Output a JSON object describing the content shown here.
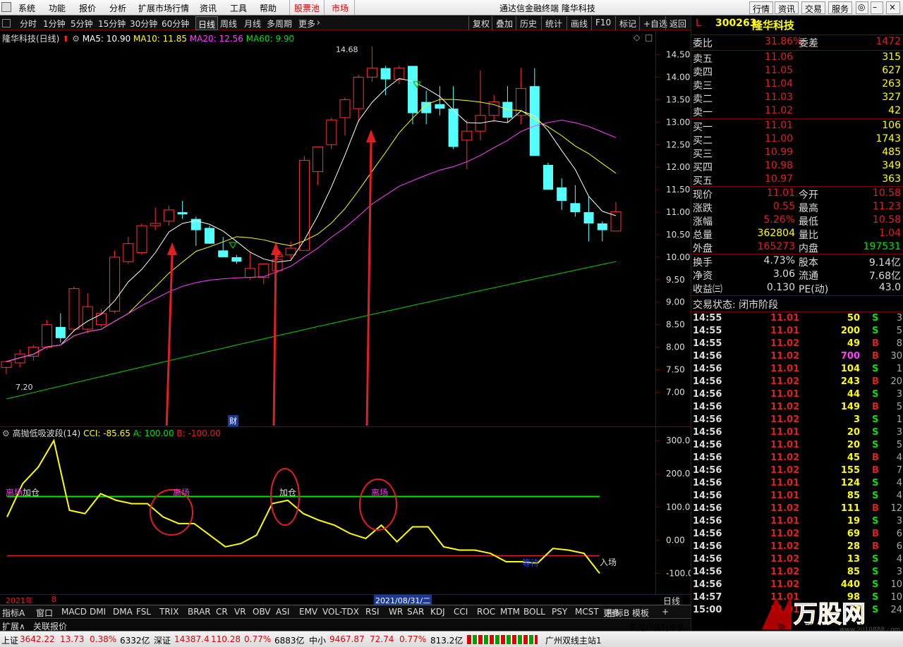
{
  "menu": {
    "items": [
      "系统",
      "功能",
      "报价",
      "分析",
      "扩展市场行情",
      "资讯",
      "工具",
      "帮助"
    ],
    "pool": "股票池",
    "market": "市场",
    "title": "通达信金融终端  隆华科技",
    "right_btns": [
      "行情",
      "资讯",
      "交易",
      "服务"
    ]
  },
  "toolbar": {
    "periods": [
      "分时",
      "1分钟",
      "5分钟",
      "15分钟",
      "30分钟",
      "60分钟",
      "日线",
      "周线",
      "月线",
      "多周期",
      "更多"
    ],
    "selected": "日线",
    "right": [
      "复权",
      "叠加",
      "历史",
      "统计",
      "画线",
      "F10",
      "标记",
      "+自选",
      "返回"
    ]
  },
  "chart_info": {
    "name": "隆华科技(日线)",
    "ma5": "MA5: 10.90",
    "ma10": "MA10: 11.85",
    "ma20": "MA20: 12.56",
    "ma60": "MA60: 9.90",
    "high_label": "14.68",
    "low_label": "7.20",
    "cai": "财"
  },
  "osc_info": {
    "name": "高抛低吸波段(14)",
    "cci": "CCI: -85.65",
    "a": "A: 100.00",
    "b": "B: -100.00"
  },
  "osc_labels": {
    "l1": "离场",
    "l2": "加仓",
    "l3": "离场",
    "l4": "加仓",
    "l5": "离场",
    "l6": "等待",
    "l7": "入场"
  },
  "price_ticks": [
    "14.50",
    "14.00",
    "13.50",
    "13.00",
    "12.50",
    "12.00",
    "11.50",
    "11.00",
    "10.50",
    "10.00",
    "9.50",
    "9.00",
    "8.50",
    "8.00",
    "7.50",
    "7.00"
  ],
  "osc_ticks": [
    "300.0",
    "200.0",
    "100.0",
    "0.00",
    "-100.0"
  ],
  "status": {
    "year": "2021年",
    "month": "8",
    "date": "2021/08/31/二",
    "period": "日线"
  },
  "ind_tabs": [
    "指标A",
    "窗口",
    "MACD",
    "DMI",
    "DMA",
    "FSL",
    "TRIX",
    "BRAR",
    "CR",
    "VR",
    "OBV",
    "ASI",
    "EMV",
    "VOL-TDX",
    "RSI",
    "WR",
    "SAR",
    "KDJ",
    "CCI",
    "ROC",
    "MTM",
    "BOLL",
    "PSY",
    "MCST",
    "更多"
  ],
  "ind_tabs_right": [
    "指标B",
    "模板",
    "+"
  ],
  "ext_tabs": [
    "扩展∧",
    "关联报价"
  ],
  "quote": {
    "code": "300263",
    "name": "隆华科技",
    "mark": "L",
    "webi": "委比",
    "webi_v": "31.86%",
    "weicha": "委差",
    "weicha_v": "1472",
    "asks": [
      [
        "卖五",
        "11.06",
        "315"
      ],
      [
        "卖四",
        "11.05",
        "627"
      ],
      [
        "卖三",
        "11.04",
        "263"
      ],
      [
        "卖二",
        "11.03",
        "327"
      ],
      [
        "卖一",
        "11.02",
        "42"
      ]
    ],
    "bids": [
      [
        "买一",
        "11.01",
        "106"
      ],
      [
        "买二",
        "11.00",
        "1743"
      ],
      [
        "买三",
        "10.99",
        "485"
      ],
      [
        "买四",
        "10.98",
        "349"
      ],
      [
        "买五",
        "10.97",
        "363"
      ]
    ],
    "stats": [
      [
        "现价",
        "11.01",
        "今开",
        "10.58"
      ],
      [
        "涨跌",
        "0.55",
        "最高",
        "11.23"
      ],
      [
        "涨幅",
        "5.26%",
        "最低",
        "10.58"
      ],
      [
        "总量",
        "362804",
        "量比",
        "1.04"
      ],
      [
        "外盘",
        "165273",
        "内盘",
        "197531"
      ]
    ],
    "stats2": [
      [
        "换手",
        "4.73%",
        "股本",
        "9.14亿"
      ],
      [
        "净资",
        "3.06",
        "流通",
        "7.68亿"
      ],
      [
        "收益㈢",
        "0.130",
        "PE(动)",
        "43.0"
      ]
    ],
    "trade_state": "交易状态: 闭市阶段"
  },
  "ticks": [
    [
      "14:55",
      "11.01",
      "50",
      "S",
      "3"
    ],
    [
      "14:55",
      "11.01",
      "200",
      "S",
      "5"
    ],
    [
      "14:55",
      "11.02",
      "49",
      "B",
      "8"
    ],
    [
      "14:56",
      "11.02",
      "700",
      "B",
      "30"
    ],
    [
      "14:56",
      "11.01",
      "104",
      "S",
      "1"
    ],
    [
      "14:56",
      "11.02",
      "243",
      "B",
      "20"
    ],
    [
      "14:56",
      "11.01",
      "44",
      "S",
      "3"
    ],
    [
      "14:56",
      "11.02",
      "149",
      "B",
      "5"
    ],
    [
      "14:56",
      "11.02",
      "3",
      "S",
      "1"
    ],
    [
      "14:56",
      "11.01",
      "20",
      "S",
      "3"
    ],
    [
      "14:56",
      "11.01",
      "20",
      "S",
      "5"
    ],
    [
      "14:56",
      "11.02",
      "45",
      "B",
      "4"
    ],
    [
      "14:56",
      "11.02",
      "155",
      "B",
      "7"
    ],
    [
      "14:56",
      "11.01",
      "124",
      "S",
      "4"
    ],
    [
      "14:56",
      "11.01",
      "85",
      "S",
      "4"
    ],
    [
      "14:56",
      "11.02",
      "111",
      "B",
      "12"
    ],
    [
      "14:56",
      "11.01",
      "19",
      "S",
      "3"
    ],
    [
      "14:56",
      "11.02",
      "69",
      "B",
      "6"
    ],
    [
      "14:56",
      "11.02",
      "28",
      "B",
      "6"
    ],
    [
      "14:56",
      "11.02",
      "13",
      "S",
      "4"
    ],
    [
      "14:56",
      "11.02",
      "85",
      "S",
      "3"
    ],
    [
      "14:56",
      "11.02",
      "440",
      "S",
      "10"
    ],
    [
      "14:57",
      "11.01",
      "98",
      "S",
      "10"
    ],
    [
      "15:00",
      "11.01",
      "1",
      "S",
      "24"
    ]
  ],
  "bottom": {
    "sh": "上证",
    "sh_v": "3642.22",
    "sh_c": "13.73",
    "sh_p": "0.38%",
    "sh_amt": "6332亿",
    "sz": "深证",
    "sz_v": "14387.4",
    "sz_c": "110.28",
    "sz_p": "0.77%",
    "sz_amt": "6883亿",
    "zx": "中小",
    "zx_v": "9467.87",
    "zx_c": "72.74",
    "zx_p": "0.77%",
    "zx_amt": "813.2亿",
    "station": "广州双线主站1",
    "promo": "新用户福利专享",
    "tabs": [
      "笔",
      "价",
      "细",
      "势",
      "联",
      "值",
      "主",
      "筹"
    ]
  },
  "watermark": {
    "text": "万股网",
    "url": "www.2010888.com"
  },
  "chart_data": {
    "type": "candlestick",
    "price_range": [
      6.6,
      14.9
    ],
    "candles": [
      [
        7.55,
        7.7,
        7.4,
        7.68
      ],
      [
        7.65,
        7.95,
        7.55,
        7.85
      ],
      [
        7.8,
        8.05,
        7.7,
        8.0
      ],
      [
        8.0,
        8.6,
        7.95,
        8.5
      ],
      [
        8.45,
        8.75,
        8.1,
        8.2
      ],
      [
        8.4,
        9.35,
        8.35,
        9.3
      ],
      [
        8.4,
        9.2,
        8.3,
        8.9
      ],
      [
        8.5,
        8.85,
        8.45,
        8.75
      ],
      [
        8.8,
        10.15,
        8.75,
        10.0
      ],
      [
        9.9,
        10.45,
        9.85,
        10.3
      ],
      [
        10.1,
        10.75,
        10.05,
        10.7
      ],
      [
        10.7,
        11.1,
        10.6,
        10.75
      ],
      [
        10.8,
        11.15,
        10.7,
        11.05
      ],
      [
        11.0,
        11.25,
        10.85,
        10.95
      ],
      [
        10.85,
        10.9,
        10.25,
        10.6
      ],
      [
        10.65,
        10.7,
        10.3,
        10.3
      ],
      [
        10.15,
        10.45,
        10.0,
        10.0
      ],
      [
        10.0,
        10.05,
        9.85,
        9.9
      ],
      [
        9.55,
        10.1,
        9.5,
        9.75
      ],
      [
        9.55,
        9.8,
        9.4,
        9.85
      ],
      [
        9.7,
        10.05,
        9.65,
        9.95
      ],
      [
        10.05,
        10.35,
        9.95,
        10.2
      ],
      [
        10.15,
        12.25,
        10.15,
        12.15
      ],
      [
        11.9,
        12.45,
        11.6,
        12.45
      ],
      [
        12.5,
        13.1,
        12.4,
        13.05
      ],
      [
        13.1,
        13.55,
        12.7,
        13.5
      ],
      [
        13.3,
        14.05,
        13.0,
        14.0
      ],
      [
        14.0,
        14.68,
        13.9,
        14.2
      ],
      [
        14.2,
        14.25,
        13.6,
        13.95
      ],
      [
        13.95,
        14.25,
        13.85,
        14.2
      ],
      [
        14.25,
        14.25,
        12.95,
        13.2
      ],
      [
        13.45,
        13.7,
        12.95,
        13.2
      ],
      [
        13.4,
        13.8,
        13.15,
        13.3
      ],
      [
        13.3,
        13.8,
        12.4,
        12.45
      ],
      [
        12.6,
        13.05,
        11.95,
        12.8
      ],
      [
        12.8,
        14.15,
        12.6,
        13.15
      ],
      [
        13.15,
        13.6,
        13.0,
        13.45
      ],
      [
        13.45,
        13.8,
        13.0,
        13.1
      ],
      [
        13.15,
        14.2,
        12.95,
        13.75
      ],
      [
        13.8,
        14.2,
        12.25,
        12.25
      ],
      [
        12.05,
        12.1,
        11.5,
        11.5
      ],
      [
        11.55,
        11.75,
        11.05,
        11.25
      ],
      [
        11.2,
        11.6,
        10.9,
        11.0
      ],
      [
        11.0,
        11.35,
        10.35,
        10.75
      ],
      [
        10.75,
        10.8,
        10.35,
        10.6
      ],
      [
        10.58,
        11.23,
        10.58,
        11.01
      ]
    ],
    "osc_range": [
      -150,
      330
    ],
    "cci": [
      70,
      170,
      220,
      300,
      90,
      80,
      140,
      120,
      110,
      110,
      70,
      50,
      50,
      15,
      -20,
      -10,
      15,
      110,
      120,
      80,
      60,
      45,
      20,
      5,
      45,
      -5,
      40,
      40,
      -20,
      -30,
      -30,
      -40,
      -65,
      -65,
      -70,
      -25,
      -30,
      -40,
      -100
    ]
  }
}
